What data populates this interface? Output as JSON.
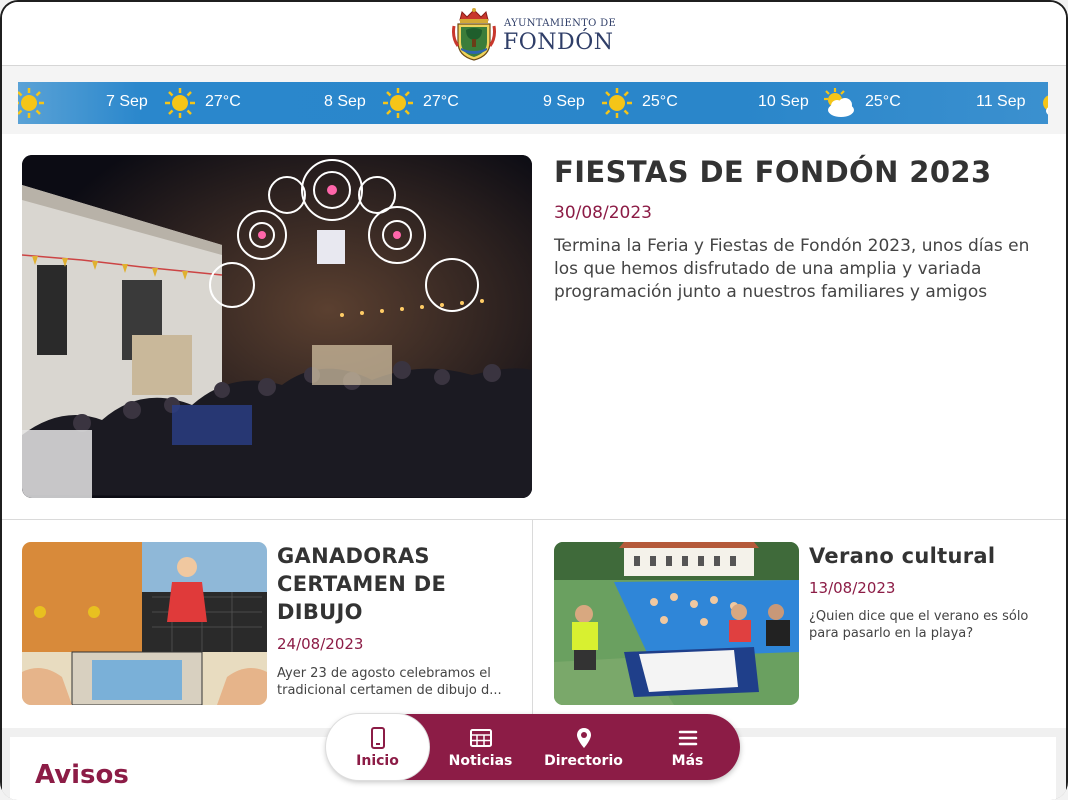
{
  "header": {
    "logo_line1": "AYUNTAMIENTO DE",
    "logo_line2": "FONDÓN"
  },
  "weather": [
    {
      "date": "7 Sep",
      "icon": "sun-icon",
      "temp": "27°C"
    },
    {
      "date": "8 Sep",
      "icon": "sun-icon",
      "temp": "27°C"
    },
    {
      "date": "9 Sep",
      "icon": "sun-icon",
      "temp": "25°C"
    },
    {
      "date": "10 Sep",
      "icon": "partly-cloudy-icon",
      "temp": "25°C"
    },
    {
      "date": "11 Sep",
      "icon": "sun-icon",
      "temp": ""
    }
  ],
  "featured": {
    "title": "FIESTAS DE FONDÓN 2023",
    "date": "30/08/2023",
    "text": "Termina la Feria y Fiestas de Fondón 2023, unos días en los que hemos disfrutado de una amplia y variada programación junto a nuestros familiares y amigos",
    "image": "fiesta-night-lights-photo"
  },
  "cards": [
    {
      "title": "GANADORAS CERTAMEN DE DIBUJO",
      "date": "24/08/2023",
      "text": "Ayer 23 de agosto celebramos el tradicional certamen de dibujo d...",
      "image": "children-drawing-photo"
    },
    {
      "title": "Verano cultural",
      "date": "13/08/2023",
      "text": "¿Quien dice que el verano es sólo para pasarlo en la playa?",
      "image": "swimming-pool-photo"
    }
  ],
  "avisos": {
    "title": "Avisos"
  },
  "nav": [
    {
      "label": "Inicio",
      "icon": "phone-icon",
      "active": true
    },
    {
      "label": "Noticias",
      "icon": "newspaper-icon",
      "active": false
    },
    {
      "label": "Directorio",
      "icon": "location-pin-icon",
      "active": false
    },
    {
      "label": "Más",
      "icon": "menu-icon",
      "active": false
    }
  ],
  "colors": {
    "brand": "#8c1c46",
    "weather_bar": "#2a86ca",
    "text": "#333333"
  }
}
